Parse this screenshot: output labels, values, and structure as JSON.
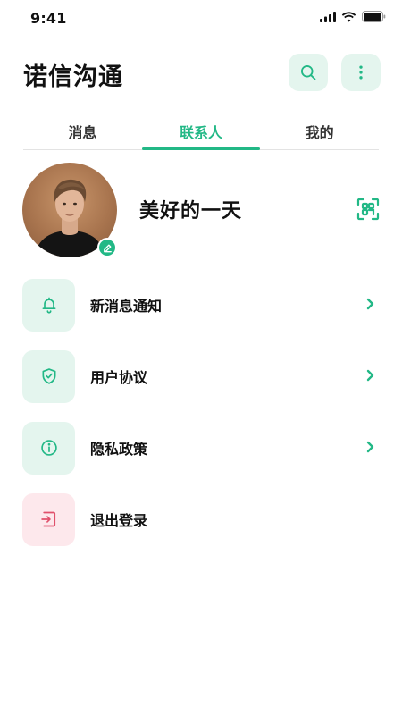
{
  "status_bar": {
    "time": "9:41"
  },
  "header": {
    "title": "诺信沟通"
  },
  "tabs": [
    {
      "label": "消息"
    },
    {
      "label": "联系人"
    },
    {
      "label": "我的"
    }
  ],
  "profile": {
    "name": "美好的一天"
  },
  "menu": [
    {
      "label": "新消息通知",
      "icon": "bell-icon"
    },
    {
      "label": "用户协议",
      "icon": "shield-check-icon"
    },
    {
      "label": "隐私政策",
      "icon": "info-circle-icon"
    },
    {
      "label": "退出登录",
      "icon": "logout-icon"
    }
  ],
  "colors": {
    "accent": "#22b886",
    "accent_light": "#e4f5ee",
    "danger": "#e0506b",
    "danger_light": "#fde8ec"
  }
}
